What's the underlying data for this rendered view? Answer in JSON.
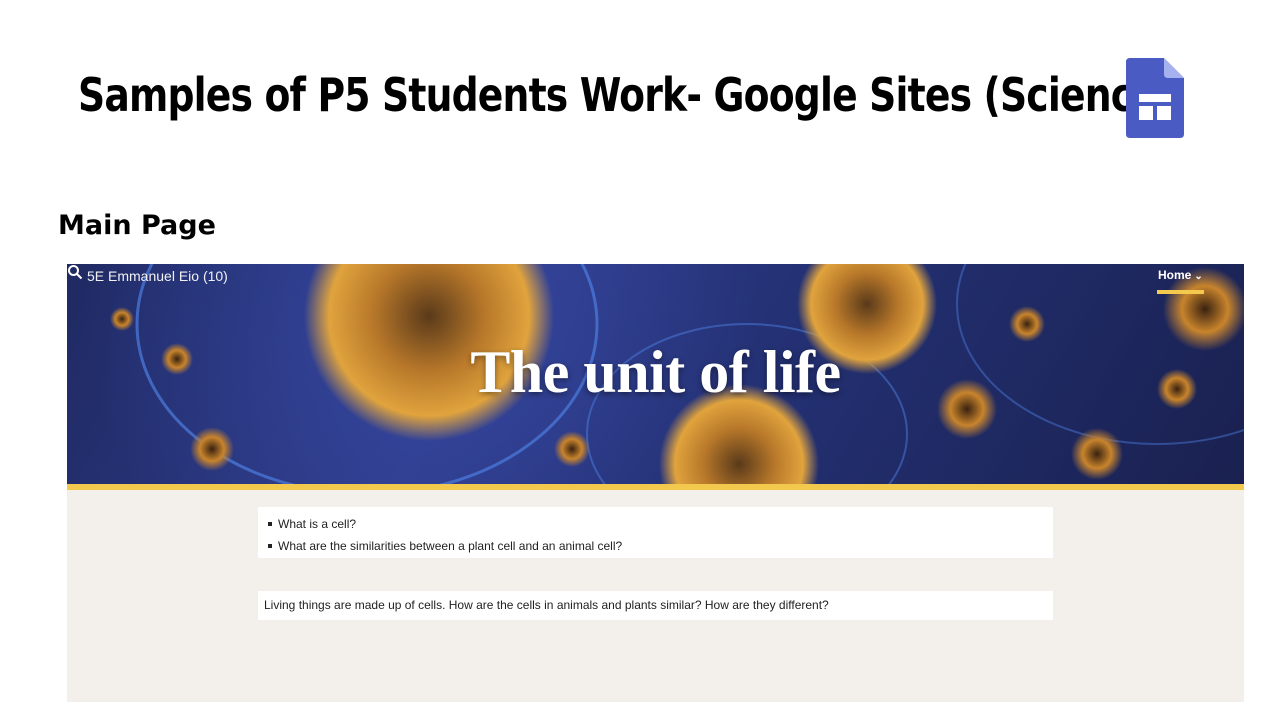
{
  "slide": {
    "title": "Samples of P5 Students Work- Google Sites (Science)",
    "section_label": "Main Page"
  },
  "logo": {
    "icon": "google-sites-icon",
    "color": "#4a5bc4"
  },
  "site": {
    "name": "5E Emmanuel Eio (10)",
    "nav": {
      "home_label": "Home",
      "search_icon": "search-icon"
    },
    "hero_title": "The unit of life",
    "accent_color": "#f2c94c",
    "questions": [
      "What is a cell?",
      "What are the similarities between a plant cell and an animal cell?"
    ],
    "intro_text": "Living things are made up of cells. How are the cells in animals and plants similar? How are they different?"
  }
}
